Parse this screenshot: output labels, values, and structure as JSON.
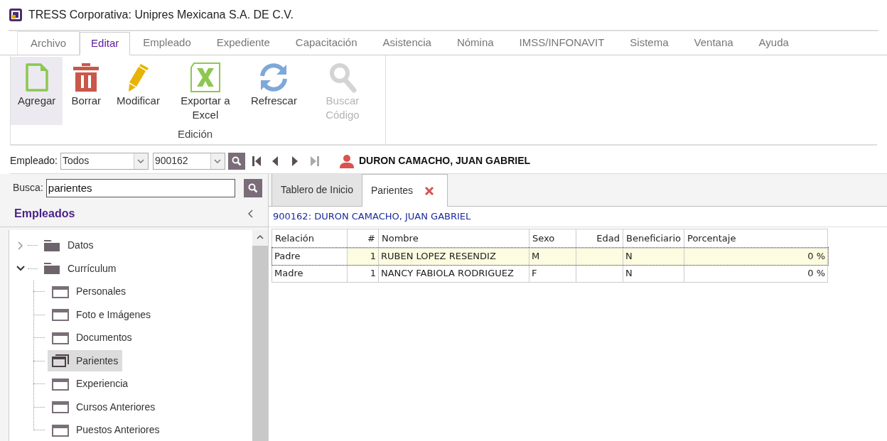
{
  "window": {
    "title": "TRESS Corporativa: Unipres Mexicana S.A. DE C.V."
  },
  "menu_tabs": [
    {
      "label": "Archivo",
      "selected": false
    },
    {
      "label": "Editar",
      "selected": true
    },
    {
      "label": "Empleado",
      "selected": false
    },
    {
      "label": "Expediente",
      "selected": false
    },
    {
      "label": "Capacitación",
      "selected": false
    },
    {
      "label": "Asistencia",
      "selected": false
    },
    {
      "label": "Nómina",
      "selected": false
    },
    {
      "label": "IMSS/INFONAVIT",
      "selected": false
    },
    {
      "label": "Sistema",
      "selected": false
    },
    {
      "label": "Ventana",
      "selected": false
    },
    {
      "label": "Ayuda",
      "selected": false
    }
  ],
  "ribbon": {
    "group_label": "Edición",
    "buttons": [
      {
        "kind": "new",
        "label": "Agregar",
        "selected": true,
        "disabled": false
      },
      {
        "kind": "delete",
        "label": "Borrar",
        "selected": false,
        "disabled": false
      },
      {
        "kind": "edit",
        "label": "Modificar",
        "selected": false,
        "disabled": false
      },
      {
        "kind": "excel",
        "label": "Exportar a Excel",
        "selected": false,
        "disabled": false
      },
      {
        "kind": "refresh",
        "label": "Refrescar",
        "selected": false,
        "disabled": false
      },
      {
        "kind": "search",
        "label": "Buscar Código",
        "selected": false,
        "disabled": true
      }
    ]
  },
  "employee_bar": {
    "label": "Empleado:",
    "filter": "Todos",
    "number": "900162",
    "name": "DURON CAMACHO, JUAN GABRIEL"
  },
  "sidebar": {
    "search_label": "Busca:",
    "search_value": "parientes",
    "title": "Empleados",
    "tree": [
      {
        "label": "Datos",
        "kind": "folder",
        "expanded": false,
        "selected": false
      },
      {
        "label": "Currículum",
        "kind": "folder",
        "expanded": true,
        "selected": false,
        "children": [
          {
            "label": "Personales",
            "kind": "form",
            "selected": false
          },
          {
            "label": "Foto e Imágenes",
            "kind": "form",
            "selected": false
          },
          {
            "label": "Documentos",
            "kind": "form",
            "selected": false
          },
          {
            "label": "Parientes",
            "kind": "form",
            "selected": true
          },
          {
            "label": "Experiencia",
            "kind": "form",
            "selected": false
          },
          {
            "label": "Cursos Anteriores",
            "kind": "form",
            "selected": false
          },
          {
            "label": "Puestos Anteriores",
            "kind": "form",
            "selected": false
          }
        ]
      }
    ]
  },
  "doc_tabs": [
    {
      "label": "Tablero de Inicio",
      "selected": false,
      "closable": false
    },
    {
      "label": "Parientes",
      "selected": true,
      "closable": true
    }
  ],
  "record_header": "900162: DURON CAMACHO, JUAN GABRIEL",
  "table": {
    "columns": [
      "Relación",
      "#",
      "Nombre",
      "Sexo",
      "Edad",
      "Beneficiario",
      "Porcentaje"
    ],
    "rows": [
      {
        "cells": [
          "Padre",
          "1",
          "RUBEN LOPEZ RESENDIZ",
          "M",
          "",
          "N",
          "0 %"
        ],
        "selected": true
      },
      {
        "cells": [
          "Madre",
          "1",
          "NANCY FABIOLA RODRIGUEZ",
          "F",
          "",
          "N",
          "0 %"
        ],
        "selected": false
      }
    ]
  }
}
